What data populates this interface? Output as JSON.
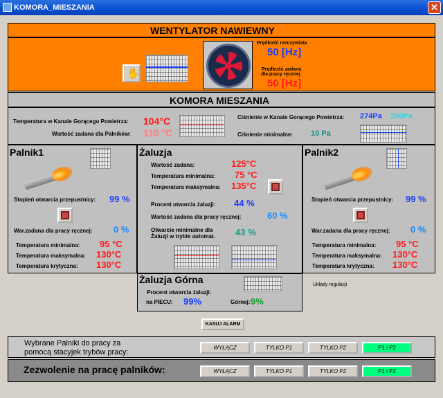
{
  "window": {
    "title": "KOMORA_MIESZANIA",
    "close_glyph": "✕"
  },
  "fan": {
    "title": "WENTYLATOR   NAWIEWNY",
    "actual_speed_label": "Prędkość rzeczywista",
    "actual_speed_value": "50 [Hz]",
    "set_speed_label_1": "Prędkość zadana",
    "set_speed_label_2": "dla pracy ręcznej",
    "set_speed_value": "50 [Hz]",
    "hand_icon": "hand-icon",
    "fan_icon": "fan-icon",
    "panel_color": "#ff8000"
  },
  "chamber": {
    "title": "KOMORA MIESZANIA",
    "hot_air_temp_label": "Temperatura w Kanale Gorącego Powietrza:",
    "hot_air_temp_value": "104°C",
    "burner_setpoint_label": "Wartość zadana dla Palników:",
    "burner_setpoint_value": "110 °C",
    "pressure_label": "Ciśnienie w Kanale Gorącego Powietrza:",
    "pressure_value": "274Pa",
    "pressure_set_value": "250Pa",
    "min_pressure_label": "Ciśnienie minimalne:",
    "min_pressure_value": "10 Pa"
  },
  "burner1": {
    "title": "Palnik1",
    "throttle_label": "Stopień otwarcia przepustnicy:",
    "throttle_value": "99 %",
    "manual_label": "War.zadana dla pracy ręcznej:",
    "manual_value": "0 %",
    "tmin_label": "Temperatura minimalna:",
    "tmin_value": "95 °C",
    "tmax_label": "Temperatura maksymalna:",
    "tmax_value": "130°C",
    "tcrit_label": "Temperatura krytyczna:",
    "tcrit_value": "130°C"
  },
  "damper": {
    "title": "Żaluzja",
    "setpoint_label": "Wartość zadana:",
    "setpoint_value": "125°C",
    "tmin_label": "Temperatura minimalna:",
    "tmin_value": "75 °C",
    "tmax_label": "Temperatura maksymalna:",
    "tmax_value": "135°C",
    "open_label": "Procent otwarcia żaluzji:",
    "open_value": "44 %",
    "manual_label": "Wartość zadana dla pracy ręcznej:",
    "manual_value": "60 %",
    "min_open_label_1": "Otwarcie minimalne dla",
    "min_open_label_2": "Żaluzji w trybie automat.",
    "min_open_value": "43 %"
  },
  "burner2": {
    "title": "Palnik2",
    "throttle_label": "Stopień otwarcia przepustnicy:",
    "throttle_value": "99 %",
    "manual_label": "War.zadana dla pracy ręcznej:",
    "manual_value": "0 %",
    "tmin_label": "Temperatura minimalna:",
    "tmin_value": "95 °C",
    "tmax_label": "Temperatura maksymalna:",
    "tmax_value": "130°C",
    "tcrit_label": "Temperatura krytyczna:",
    "tcrit_value": "130°C"
  },
  "upper_damper": {
    "title": "Żaluzja Górna",
    "open_label": "Procent otwarcia żaluzji:",
    "piec_label": "na PIECU:",
    "piec_value": "99%",
    "top_label": "Górnej:",
    "top_value": "9%"
  },
  "misc": {
    "regulation_label": "Układy regulacji",
    "alarm_button": "KASUJ ALARM"
  },
  "selection": {
    "label_1": "Wybrane Palniki do pracy za",
    "label_2": "pomocą stacyjek trybów pracy:",
    "buttons": [
      "WYŁĄCZ",
      "TYLKO P1",
      "TYLKO P2",
      "P1 i P2"
    ],
    "active": 3
  },
  "permission": {
    "label": "Zezwolenie na pracę palników:",
    "buttons": [
      "WYŁĄCZ",
      "TYLKO P1",
      "TYLKO P2",
      "P1 i P2"
    ],
    "active": 3
  }
}
